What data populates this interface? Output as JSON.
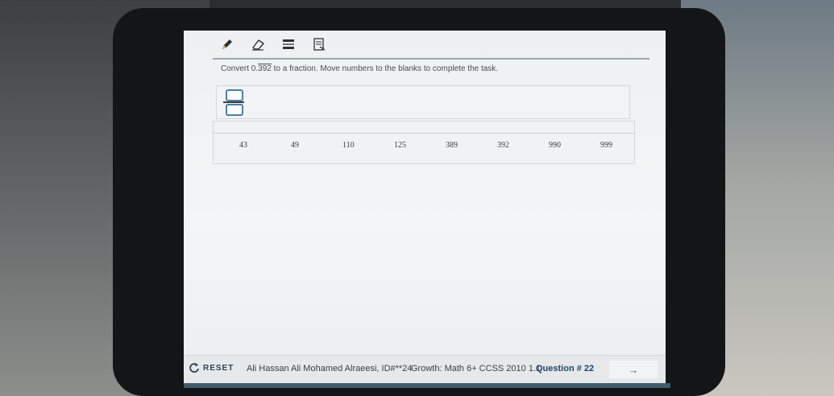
{
  "prompt": {
    "before": "Convert 0.",
    "repeating": "392",
    "after": " to a fraction. Move numbers to the blanks to complete the task."
  },
  "toolbar": {
    "tools": [
      {
        "icon": "pencil-icon"
      },
      {
        "icon": "eraser-icon"
      },
      {
        "icon": "line-reader-icon"
      },
      {
        "icon": "notepad-icon"
      }
    ]
  },
  "number_bank": [
    "43",
    "49",
    "110",
    "125",
    "389",
    "392",
    "990",
    "999"
  ],
  "footer": {
    "reset_label": "RESET",
    "student": "Ali Hassan Ali Mohamed Alraeesi, ID#**24",
    "test": "Growth: Math 6+ CCSS 2010 1.1",
    "question": "Question # 22",
    "next_symbol": "→"
  },
  "colors": {
    "accent": "#4b7fa8",
    "question_blue": "#22456b"
  }
}
